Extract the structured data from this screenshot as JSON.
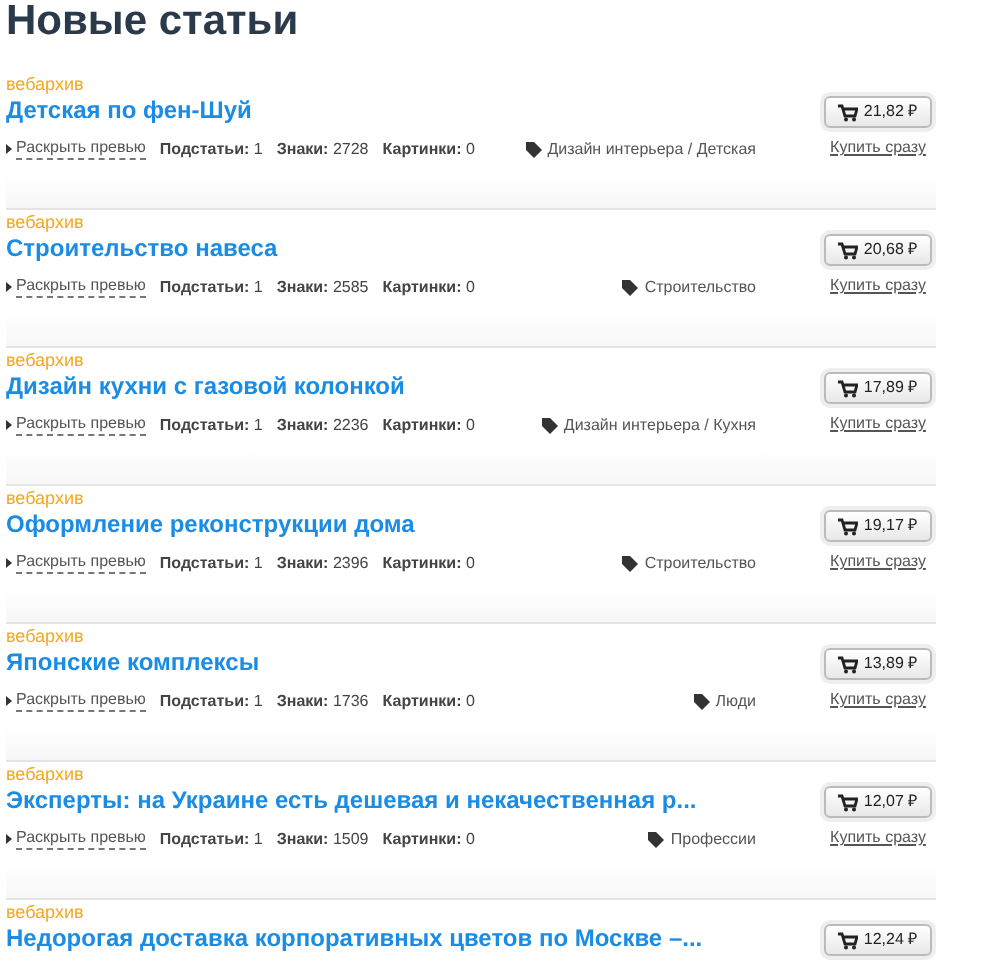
{
  "heading": "Новые статьи",
  "articles": [
    {
      "author": "вебархив",
      "title": "Детская по фен-Шуй",
      "preview_link": "Раскрыть превью",
      "stats": [
        "**Подстатьи:** 1",
        "**Знаки:** 2728",
        "**Картинки:** 0"
      ],
      "tag": "Дизайн интерьера / Детская",
      "price": "21,82 ₽",
      "buy_link": "Купить сразу"
    },
    {
      "author": "вебархив",
      "title": "Строительство навеса",
      "preview_link": "Раскрыть превью",
      "stats": [
        "**Подстатьи:** 1",
        "**Знаки:** 2585",
        "**Картинки:** 0"
      ],
      "tag": "Строительство",
      "price": "20,68 ₽",
      "buy_link": "Купить сразу"
    },
    {
      "author": "вебархив",
      "title": "Дизайн кухни с газовой колонкой",
      "preview_link": "Раскрыть превью",
      "stats": [
        "**Подстатьи:** 1",
        "**Знаки:** 2236",
        "**Картинки:** 0"
      ],
      "tag": "Дизайн интерьера / Кухня",
      "price": "17,89 ₽",
      "buy_link": "Купить сразу"
    },
    {
      "author": "вебархив",
      "title": "Оформление реконструкции дома",
      "preview_link": "Раскрыть превью",
      "stats": [
        "**Подстатьи:** 1",
        "**Знаки:** 2396",
        "**Картинки:** 0"
      ],
      "tag": "Строительство",
      "price": "19,17 ₽",
      "buy_link": "Купить сразу"
    },
    {
      "author": "вебархив",
      "title": "Японские комплексы",
      "preview_link": "Раскрыть превью",
      "stats": [
        "**Подстатьи:** 1",
        "**Знаки:** 1736",
        "**Картинки:** 0"
      ],
      "tag": "Люди",
      "price": "13,89 ₽",
      "buy_link": "Купить сразу"
    },
    {
      "author": "вебархив",
      "title": "Эксперты: на Украине есть дешевая и некачественная р...",
      "preview_link": "Раскрыть превью",
      "stats": [
        "**Подстатьи:** 1",
        "**Знаки:** 1509",
        "**Картинки:** 0"
      ],
      "tag": "Профессии",
      "price": "12,07 ₽",
      "buy_link": "Купить сразу"
    },
    {
      "author": "вебархив",
      "title": "Недорогая доставка корпоративных цветов по Москве –...",
      "price": "12,24 ₽"
    }
  ]
}
